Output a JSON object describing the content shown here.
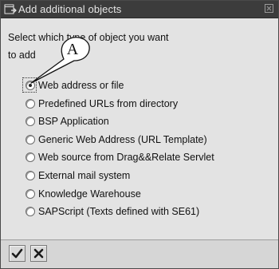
{
  "dialog": {
    "title": "Add additional objects",
    "prompt_line1": "Select which type of object you want",
    "prompt_line2": "to add",
    "callout_label": "A",
    "options": [
      {
        "label": "Web address or file",
        "selected": true
      },
      {
        "label": "Predefined URLs from directory",
        "selected": false
      },
      {
        "label": "BSP Application",
        "selected": false
      },
      {
        "label": "Generic Web Address (URL Template)",
        "selected": false
      },
      {
        "label": "Web source from Drag&&Relate Servlet",
        "selected": false
      },
      {
        "label": "External mail system",
        "selected": false
      },
      {
        "label": "Knowledge Warehouse",
        "selected": false
      },
      {
        "label": "SAPScript (Texts defined with SE61)",
        "selected": false
      }
    ]
  },
  "footer": {
    "confirm_icon": "checkmark-icon",
    "cancel_icon": "x-cancel-icon"
  }
}
